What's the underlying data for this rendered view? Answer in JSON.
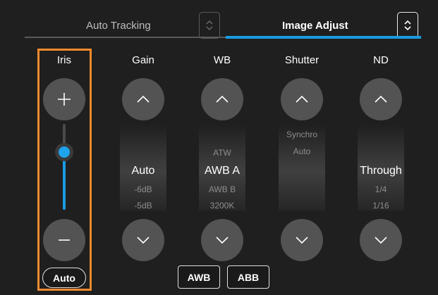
{
  "tabs": [
    {
      "label": "Auto Tracking",
      "active": false
    },
    {
      "label": "Image Adjust",
      "active": true
    }
  ],
  "colors": {
    "accent": "#1a9be0",
    "highlight_frame": "#ef8a2e",
    "button": "#535353",
    "background": "#1f1f1f"
  },
  "icons": {
    "stepper": "up-down-chevron-icon",
    "up": "chevron-up-icon",
    "down": "chevron-down-icon",
    "plus": "plus-icon",
    "minus": "minus-icon"
  },
  "iris": {
    "title": "Iris",
    "auto_label": "Auto",
    "slider_level": 0.55
  },
  "gain": {
    "title": "Gain",
    "options": [
      "Auto",
      "-6dB",
      "-5dB"
    ],
    "selected": "Auto"
  },
  "wb": {
    "title": "WB",
    "options": [
      "ATW",
      "AWB A",
      "AWB B",
      "3200K"
    ],
    "selected": "AWB A"
  },
  "shutter": {
    "title": "Shutter",
    "options": [
      "Synchro",
      "Auto"
    ],
    "selected": ""
  },
  "nd": {
    "title": "ND",
    "options": [
      "Through",
      "1/4",
      "1/16"
    ],
    "selected": "Through"
  },
  "bottom_buttons": {
    "awb": "AWB",
    "abb": "ABB"
  }
}
